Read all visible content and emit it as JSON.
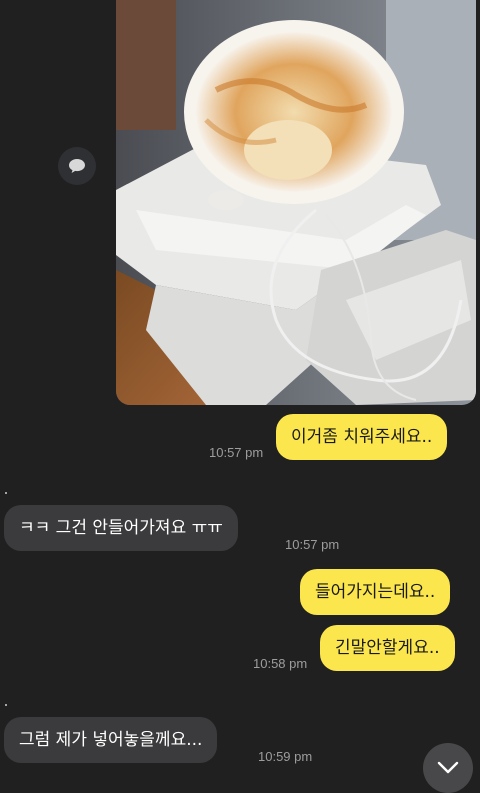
{
  "messages": [
    {
      "text": "이거좀 치워주세요..",
      "time": "10:57 pm"
    },
    {
      "text": "ㅋㅋ 그건 안들어가져요 ㅠㅠ",
      "time": "10:57 pm"
    },
    {
      "text": "들어가지는데요..",
      "time": ""
    },
    {
      "text": "긴말안할게요..",
      "time": "10:58 pm"
    },
    {
      "text": "그럼 제가 넣어놓을께요...",
      "time": "10:59 pm"
    }
  ],
  "colors": {
    "background": "#202021",
    "my_bubble": "#fbe64d",
    "their_bubble": "#3b3b3d",
    "timestamp": "#9d9d9d"
  },
  "icons": {
    "share": "speech-bubble-icon",
    "scroll": "chevron-down-icon"
  }
}
